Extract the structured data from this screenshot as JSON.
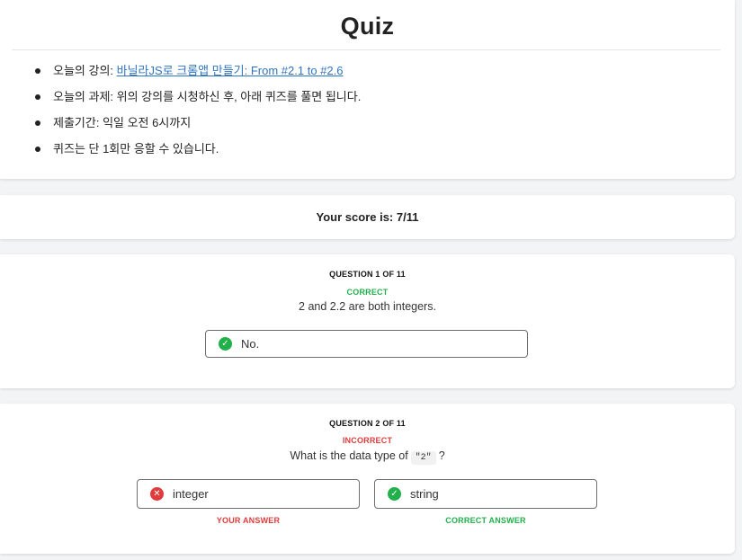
{
  "header": {
    "title": "Quiz",
    "items": [
      {
        "label": "오늘의 강의: ",
        "link": "바닐라JS로 크롬앱 만들기: From #2.1 to #2.6"
      },
      {
        "label": "오늘의 과제: 위의 강의를 시청하신 후, 아래 퀴즈를 풀면 됩니다."
      },
      {
        "label": "제출기간: 익일 오전 6시까지"
      },
      {
        "label": "퀴즈는 단 1회만 응할 수 있습니다."
      }
    ]
  },
  "score": {
    "text": "Your score is: 7/11"
  },
  "questions": [
    {
      "number": "QUESTION 1 OF 11",
      "status": "CORRECT",
      "text": "2 and 2.2 are both integers.",
      "answers": [
        {
          "label": "No.",
          "icon": "check-icon"
        }
      ]
    },
    {
      "number": "QUESTION 2 OF 11",
      "status": "INCORRECT",
      "text_before": "What is the data type of",
      "code": "\"2\"",
      "text_after": "?",
      "answers": [
        {
          "label": "integer",
          "icon": "x-icon",
          "caption": "YOUR ANSWER"
        },
        {
          "label": "string",
          "icon": "check-icon",
          "caption": "CORRECT ANSWER"
        }
      ]
    }
  ],
  "colors": {
    "correct": "#22b04b",
    "incorrect": "#e03b3b",
    "link": "#2f74c0"
  }
}
